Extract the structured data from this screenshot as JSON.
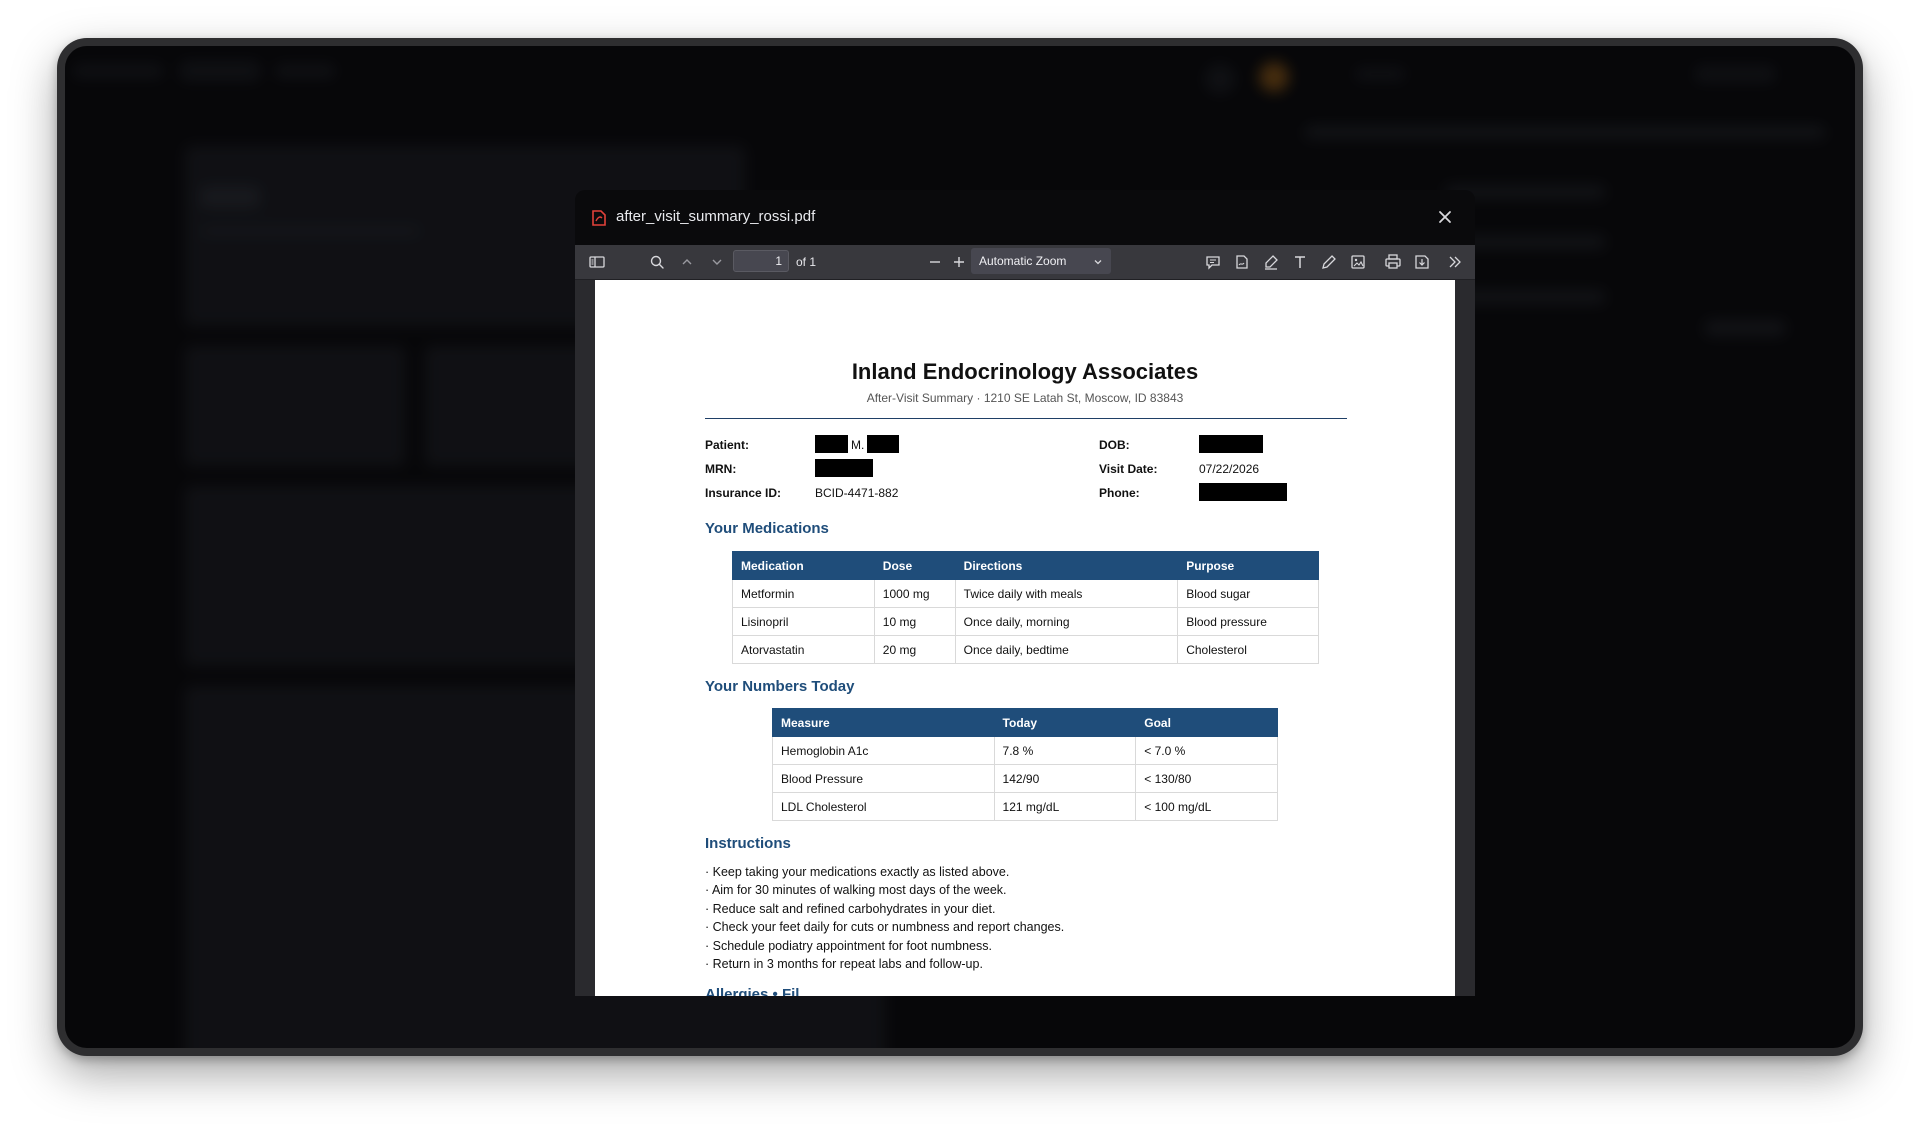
{
  "viewer": {
    "file_name": "after_visit_summary_rossi.pdf",
    "page_current": "1",
    "page_count": "of 1",
    "zoom_level": "Automatic Zoom"
  },
  "document": {
    "title": "Inland Endocrinology Associates",
    "subtitle": "After-Visit Summary · 1210 SE Latah St, Moscow, ID 83843",
    "patient": {
      "patient_label": "Patient:",
      "patient_initial": "M.",
      "mrn_label": "MRN:",
      "insurance_label": "Insurance ID:",
      "insurance_value": "BCID-4471-882",
      "dob_label": "DOB:",
      "visit_date_label": "Visit Date:",
      "visit_date_value": "07/22/2026",
      "phone_label": "Phone:"
    },
    "medications": {
      "heading": "Your Medications",
      "columns": [
        "Medication",
        "Dose",
        "Directions",
        "Purpose"
      ],
      "rows": [
        [
          "Metformin",
          "1000 mg",
          "Twice daily with meals",
          "Blood sugar"
        ],
        [
          "Lisinopril",
          "10 mg",
          "Once daily, morning",
          "Blood pressure"
        ],
        [
          "Atorvastatin",
          "20 mg",
          "Once daily, bedtime",
          "Cholesterol"
        ]
      ]
    },
    "numbers": {
      "heading": "Your Numbers Today",
      "columns": [
        "Measure",
        "Today",
        "Goal"
      ],
      "rows": [
        [
          "Hemoglobin A1c",
          "7.8 %",
          "< 7.0 %"
        ],
        [
          "Blood Pressure",
          "142/90",
          "< 130/80"
        ],
        [
          "LDL Cholesterol",
          "121 mg/dL",
          "< 100 mg/dL"
        ]
      ]
    },
    "instructions": {
      "heading": "Instructions",
      "items": [
        "· Keep taking your medications exactly as listed above.",
        "· Aim for 30 minutes of walking most days of the week.",
        "· Reduce salt and refined carbohydrates in your diet.",
        "· Check your feet daily for cuts or numbness and report changes.",
        "· Schedule podiatry appointment for foot numbness.",
        "· Return in 3 months for repeat labs and follow-up."
      ]
    },
    "next_heading_partial": "Allergies • Fil"
  },
  "colors": {
    "table_header": "#1f4d7a",
    "section_heading": "#1f4d7a",
    "toolbar": "#38383d",
    "pdf_icon": "#e2413a",
    "redaction": "#000000"
  }
}
